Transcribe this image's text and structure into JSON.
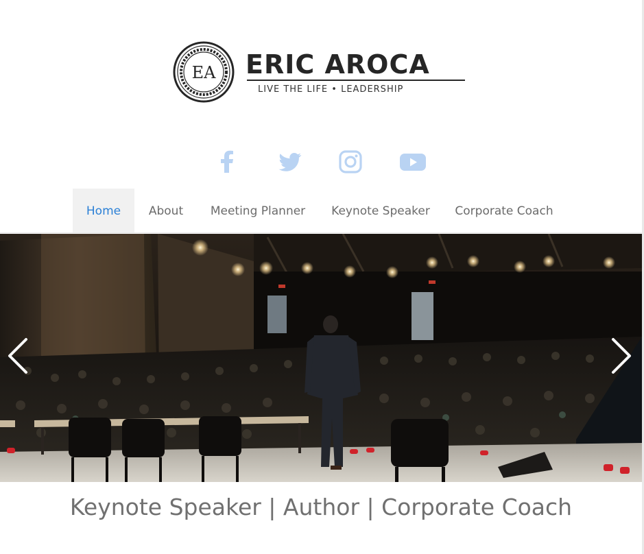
{
  "brand": {
    "monogram": "EA",
    "name": "ERIC AROCA",
    "tagline": "LIVE THE LIFE  •  LEADERSHIP"
  },
  "social": {
    "icon_color": "#b9d3f3",
    "items": [
      {
        "icon": "facebook-icon"
      },
      {
        "icon": "twitter-icon"
      },
      {
        "icon": "instagram-icon"
      },
      {
        "icon": "youtube-icon"
      }
    ]
  },
  "nav": {
    "active_color": "#2b80d6",
    "items": [
      {
        "label": "Home",
        "active": true
      },
      {
        "label": "About",
        "active": false
      },
      {
        "label": "Meeting Planner",
        "active": false
      },
      {
        "label": "Keynote Speaker",
        "active": false
      },
      {
        "label": "Corporate Coach",
        "active": false
      }
    ]
  },
  "slider": {
    "image": "speaker-on-stage-photo",
    "prev_icon": "chevron-left-icon",
    "next_icon": "chevron-right-icon"
  },
  "subtitle": "Keynote Speaker | Author | Corporate Coach"
}
